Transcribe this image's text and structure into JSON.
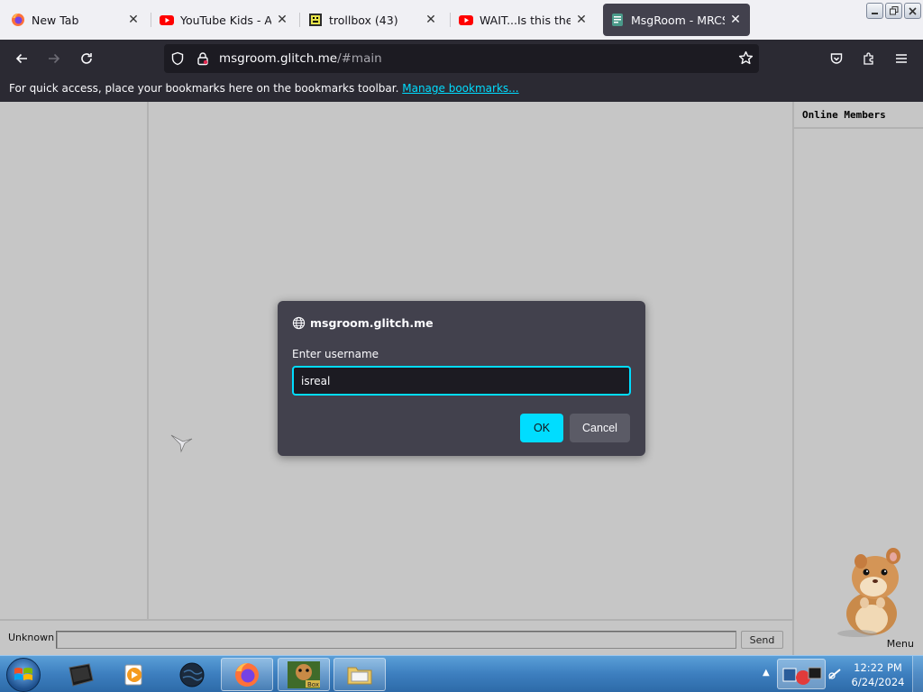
{
  "tabs": [
    {
      "title": "New Tab",
      "favicon": "firefox-icon",
      "active": false
    },
    {
      "title": "YouTube Kids - An A",
      "favicon": "youtube-icon",
      "active": false
    },
    {
      "title": "trollbox (43)",
      "favicon": "trollbox-icon",
      "active": false
    },
    {
      "title": "WAIT...Is this the BIR",
      "favicon": "youtube-icon",
      "active": false
    },
    {
      "title": "MsgRoom - MRCS C",
      "favicon": "msgroom-icon",
      "active": true
    }
  ],
  "navbar": {
    "url_host": "msgroom.glitch.me",
    "url_path": "/#main"
  },
  "bookmarks_bar": {
    "message": "For quick access, place your bookmarks here on the bookmarks toolbar.",
    "link": "Manage bookmarks..."
  },
  "page": {
    "members_title": "Online Members",
    "nickname": "Unknown",
    "send_label": "Send",
    "menu_label": "Menu"
  },
  "dialog": {
    "origin": "msgroom.glitch.me",
    "prompt": "Enter username",
    "value": "isreal",
    "ok_label": "OK",
    "cancel_label": "Cancel"
  },
  "taskbar": {
    "time": "12:22 PM",
    "date": "6/24/2024"
  },
  "colors": {
    "accent": "#00ddff",
    "toolbar": "#2b2a33",
    "page_bg": "#c6c6c6"
  }
}
